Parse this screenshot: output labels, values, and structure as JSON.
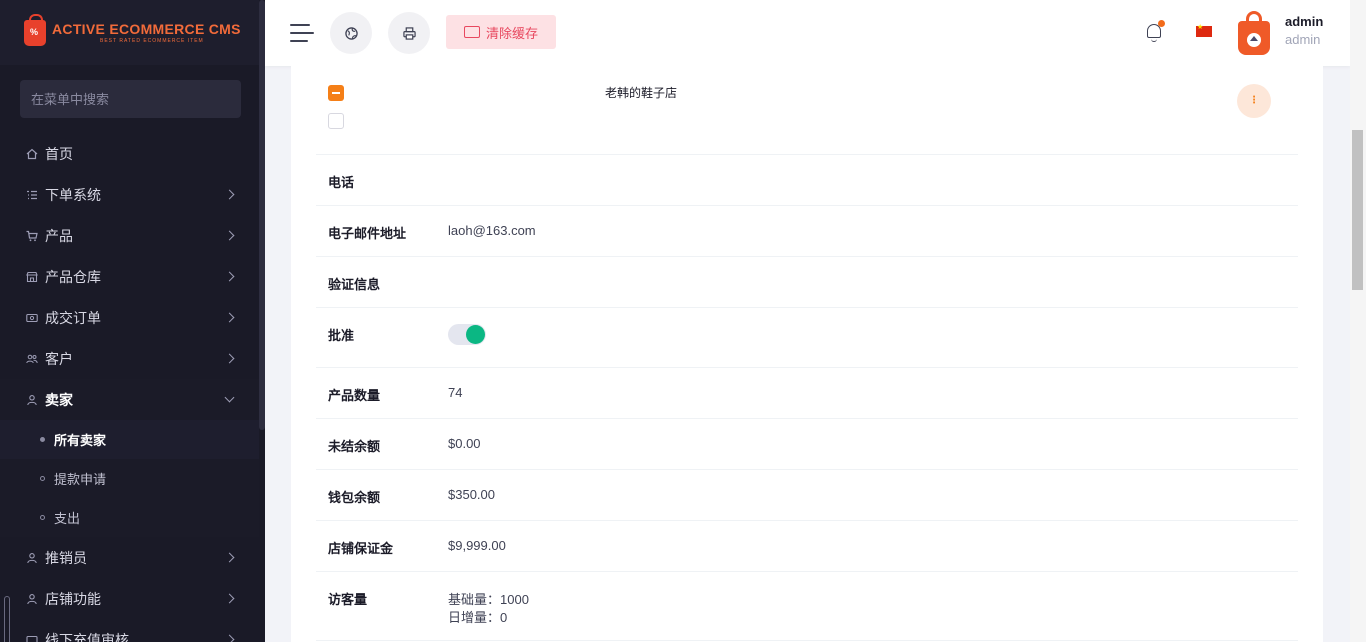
{
  "brand": {
    "title": "ACTIVE ECOMMERCE CMS",
    "subtitle": "BEST RATED ECOMMERCE ITEM"
  },
  "sidebar": {
    "search_placeholder": "在菜单中搜索",
    "items": [
      {
        "label": "首页",
        "icon": "home-icon",
        "has_children": false
      },
      {
        "label": "下单系统",
        "icon": "list-icon",
        "has_children": true
      },
      {
        "label": "产品",
        "icon": "cart-icon",
        "has_children": true
      },
      {
        "label": "产品仓库",
        "icon": "store-icon",
        "has_children": true
      },
      {
        "label": "成交订单",
        "icon": "money-icon",
        "has_children": true
      },
      {
        "label": "客户",
        "icon": "users-icon",
        "has_children": true
      },
      {
        "label": "卖家",
        "icon": "user-icon",
        "has_children": true,
        "open": true
      }
    ],
    "seller_sub": [
      {
        "label": "所有卖家",
        "active": true
      },
      {
        "label": "提款申请",
        "active": false
      },
      {
        "label": "支出",
        "active": false
      }
    ],
    "items_after": [
      {
        "label": "推销员",
        "icon": "user-icon",
        "has_children": true
      },
      {
        "label": "店铺功能",
        "icon": "user-icon",
        "has_children": true
      },
      {
        "label": "线下充值审核",
        "icon": "wallet-icon",
        "has_children": true
      }
    ]
  },
  "header": {
    "clear_cache_label": "清除缓存",
    "user_name": "admin",
    "user_role": "admin",
    "accent_color": "#f57f17"
  },
  "detail": {
    "shop_name": "老韩的鞋子店",
    "kebab_label": "⋮",
    "rows": {
      "phone": {
        "label": "电话",
        "value": ""
      },
      "email": {
        "label": "电子邮件地址",
        "value": "laoh@163.com"
      },
      "verification": {
        "label": "验证信息",
        "value": ""
      },
      "approval": {
        "label": "批准",
        "enabled": true
      },
      "product_count": {
        "label": "产品数量",
        "value": "74"
      },
      "due_balance": {
        "label": "未结余额",
        "value": "$0.00"
      },
      "wallet_balance": {
        "label": "钱包余额",
        "value": "$350.00"
      },
      "deposit": {
        "label": "店铺保证金",
        "value": "$9,999.00"
      },
      "visitors": {
        "label": "访客量",
        "base": "基础量：1000",
        "daily": "日增量：0"
      }
    }
  }
}
